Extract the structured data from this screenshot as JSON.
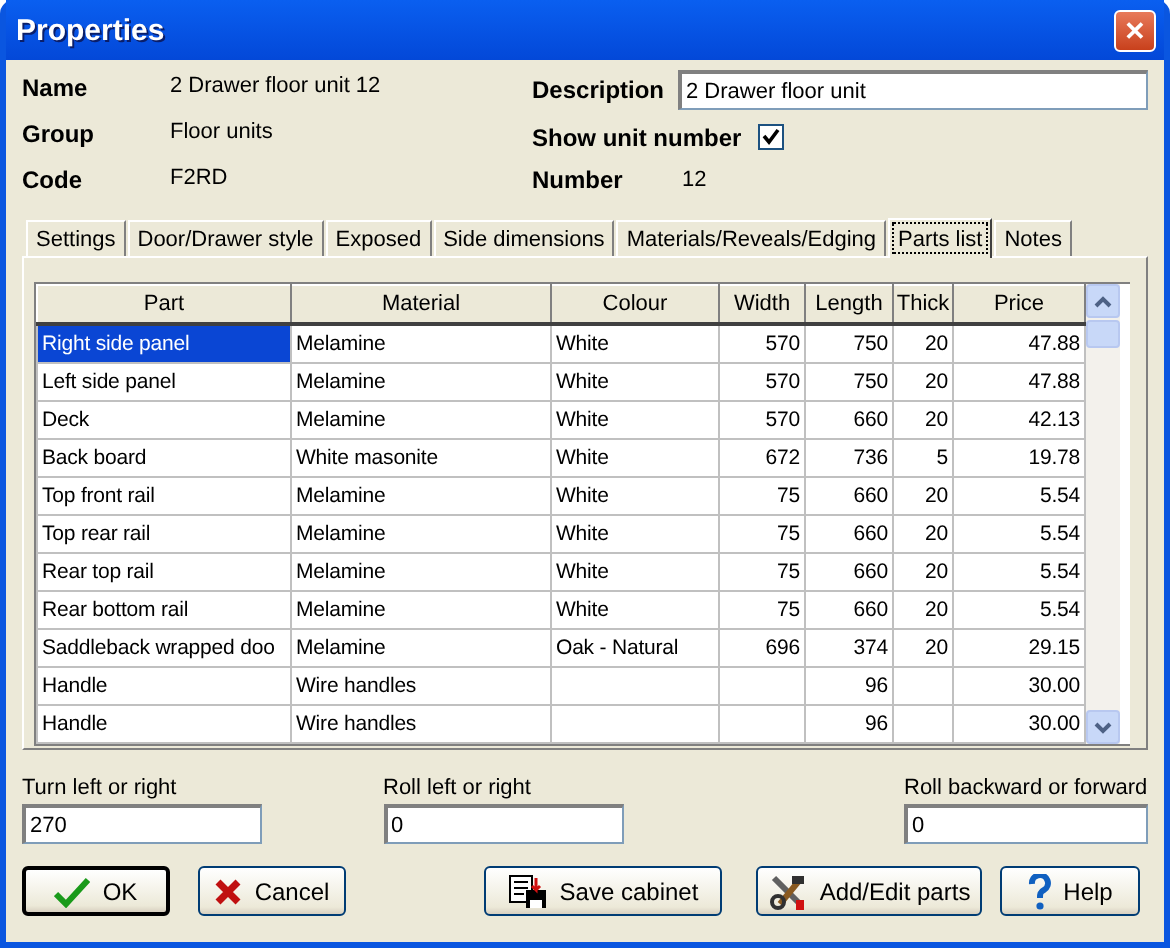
{
  "window": {
    "title": "Properties",
    "close": "✕"
  },
  "info": {
    "left": [
      {
        "label": "Name",
        "value": "2 Drawer floor unit 12"
      },
      {
        "label": "Group",
        "value": "Floor units"
      },
      {
        "label": "Code",
        "value": "F2RD"
      }
    ],
    "description": {
      "label": "Description",
      "value": "2 Drawer floor unit"
    },
    "show_unit_number": {
      "label": "Show unit number",
      "checked": true
    },
    "number": {
      "label": "Number",
      "value": "12"
    }
  },
  "tabs": [
    {
      "label": "Settings",
      "selected": false
    },
    {
      "label": "Door/Drawer style",
      "selected": false
    },
    {
      "label": "Exposed",
      "selected": false
    },
    {
      "label": "Side dimensions",
      "selected": false
    },
    {
      "label": "Materials/Reveals/Edging",
      "selected": false
    },
    {
      "label": "Parts list",
      "selected": true
    },
    {
      "label": "Notes",
      "selected": false
    }
  ],
  "table": {
    "columns": [
      "Part",
      "Material",
      "Colour",
      "Width",
      "Length",
      "Thick",
      "Price"
    ],
    "rows": [
      {
        "cells": [
          "Right side panel",
          "Melamine",
          "White",
          "570",
          "750",
          "20",
          "47.88"
        ],
        "selected": true
      },
      {
        "cells": [
          "Left side panel",
          "Melamine",
          "White",
          "570",
          "750",
          "20",
          "47.88"
        ],
        "selected": false
      },
      {
        "cells": [
          "Deck",
          "Melamine",
          "White",
          "570",
          "660",
          "20",
          "42.13"
        ],
        "selected": false
      },
      {
        "cells": [
          "Back board",
          "White masonite",
          "White",
          "672",
          "736",
          "5",
          "19.78"
        ],
        "selected": false
      },
      {
        "cells": [
          "Top front rail",
          "Melamine",
          "White",
          "75",
          "660",
          "20",
          "5.54"
        ],
        "selected": false
      },
      {
        "cells": [
          "Top rear rail",
          "Melamine",
          "White",
          "75",
          "660",
          "20",
          "5.54"
        ],
        "selected": false
      },
      {
        "cells": [
          "Rear top rail",
          "Melamine",
          "White",
          "75",
          "660",
          "20",
          "5.54"
        ],
        "selected": false
      },
      {
        "cells": [
          "Rear bottom rail",
          "Melamine",
          "White",
          "75",
          "660",
          "20",
          "5.54"
        ],
        "selected": false
      },
      {
        "cells": [
          "Saddleback wrapped doo",
          "Melamine",
          "Oak - Natural",
          "696",
          "374",
          "20",
          "29.15"
        ],
        "selected": false
      },
      {
        "cells": [
          "Handle",
          "Wire handles",
          "",
          "",
          "96",
          "",
          "30.00"
        ],
        "selected": false
      },
      {
        "cells": [
          "Handle",
          "Wire handles",
          "",
          "",
          "96",
          "",
          "30.00"
        ],
        "selected": false
      }
    ]
  },
  "rotation": [
    {
      "label": "Turn left or right",
      "value": "270"
    },
    {
      "label": "Roll left or right",
      "value": "0"
    },
    {
      "label": "Roll backward or forward",
      "value": "0"
    }
  ],
  "buttons": [
    {
      "label": "OK",
      "kind": "ok"
    },
    {
      "label": "Cancel",
      "kind": "cancel"
    },
    {
      "label": "Save cabinet",
      "kind": "save"
    },
    {
      "label": "Add/Edit parts",
      "kind": "tools"
    },
    {
      "label": "Help",
      "kind": "help"
    }
  ]
}
